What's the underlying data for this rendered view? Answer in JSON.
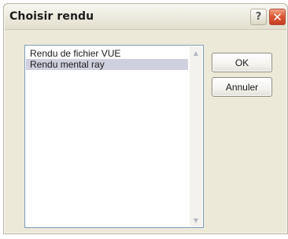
{
  "window": {
    "title": "Choisir rendu",
    "help_glyph": "?",
    "close_glyph": "✕"
  },
  "render_list": {
    "items": [
      {
        "label": "Rendu de fichier VUE",
        "selected": false
      },
      {
        "label": "Rendu mental ray",
        "selected": true
      }
    ]
  },
  "buttons": {
    "ok_label": "OK",
    "cancel_label": "Annuler"
  },
  "icons": {
    "scroll_up": "up-arrow",
    "scroll_down": "down-arrow"
  },
  "colors": {
    "dialog_bg": "#ece9d8",
    "close_button": "#dd5a37",
    "selection": "#cfd0de",
    "list_border": "#7f9db9"
  }
}
